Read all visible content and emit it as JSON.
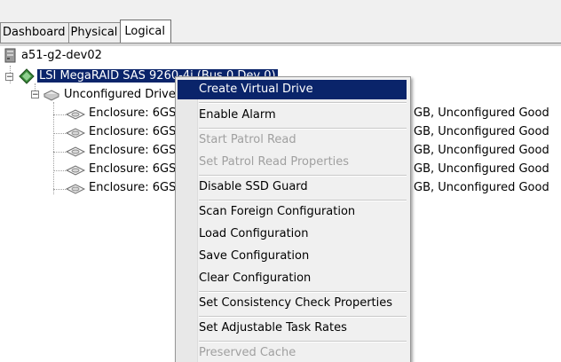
{
  "tabs": [
    {
      "label": "Dashboard",
      "active": false
    },
    {
      "label": "Physical",
      "active": false
    },
    {
      "label": "Logical",
      "active": true
    }
  ],
  "tree": {
    "host": "a51-g2-dev02",
    "controller": "LSI MegaRAID SAS 9260-4i (Bus 0,Dev 0)",
    "group": "Unconfigured Drives",
    "drives": [
      {
        "label": "Enclosure: 6GS",
        "status": "GB, Unconfigured Good"
      },
      {
        "label": "Enclosure: 6GS",
        "status": "GB, Unconfigured Good"
      },
      {
        "label": "Enclosure: 6GS",
        "status": "GB, Unconfigured Good"
      },
      {
        "label": "Enclosure: 6GS",
        "status": "GB, Unconfigured Good"
      },
      {
        "label": "Enclosure: 6GS",
        "status": "GB, Unconfigured Good"
      }
    ]
  },
  "context_menu": {
    "items": [
      {
        "label": "Create Virtual Drive",
        "enabled": true,
        "highlighted": true
      },
      {
        "label": "Enable Alarm",
        "enabled": true
      },
      {
        "label": "Start Patrol Read",
        "enabled": false
      },
      {
        "label": "Set Patrol Read Properties",
        "enabled": false
      },
      {
        "label": "Disable SSD Guard",
        "enabled": true
      },
      {
        "label": "Scan Foreign Configuration",
        "enabled": true
      },
      {
        "label": "Load Configuration",
        "enabled": true
      },
      {
        "label": "Save Configuration",
        "enabled": true
      },
      {
        "label": "Clear Configuration",
        "enabled": true
      },
      {
        "label": "Set Consistency Check Properties",
        "enabled": true
      },
      {
        "label": "Set Adjustable Task Rates",
        "enabled": true
      },
      {
        "label": "Preserved Cache",
        "enabled": false
      }
    ]
  },
  "colors": {
    "selection": "#0a246a",
    "controller_icon": "#3a8a3a",
    "disabled_text": "#a0a0a0"
  }
}
